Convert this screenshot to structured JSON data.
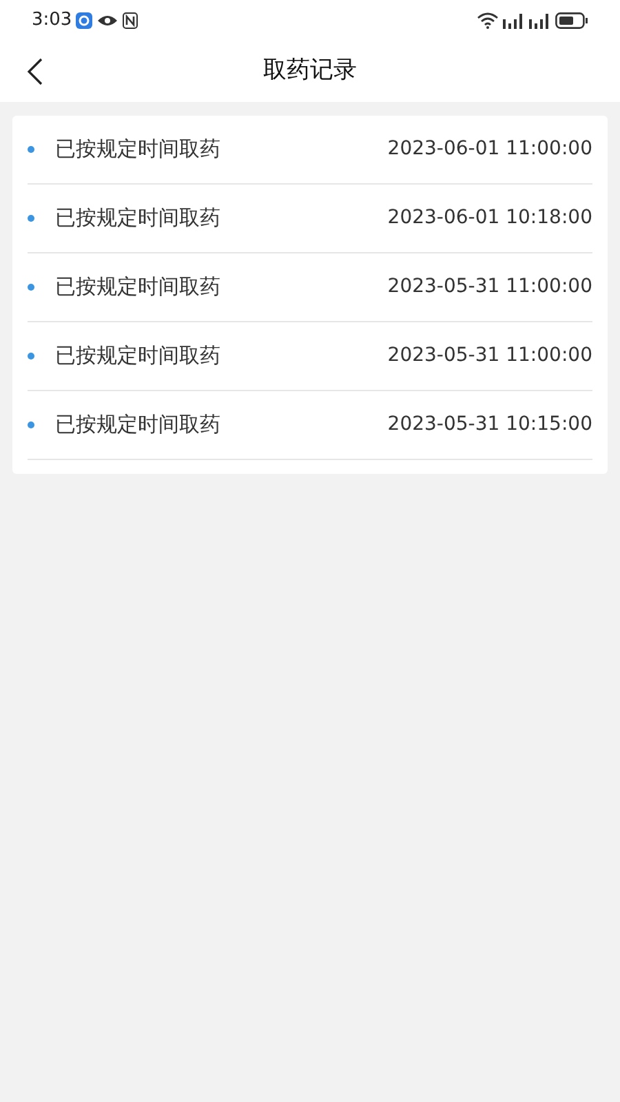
{
  "status_bar": {
    "time": "3:03"
  },
  "header": {
    "title": "取药记录"
  },
  "records": [
    {
      "label": "已按规定时间取药",
      "time": "2023-06-01 11:00:00",
      "color": "#3b95e0"
    },
    {
      "label": "已按规定时间取药",
      "time": "2023-06-01 10:18:00",
      "color": "#3b95e0"
    },
    {
      "label": "已按规定时间取药",
      "time": "2023-05-31 11:00:00",
      "color": "#3b95e0"
    },
    {
      "label": "已按规定时间取药",
      "time": "2023-05-31 11:00:00",
      "color": "#3b95e0"
    },
    {
      "label": "已按规定时间取药",
      "time": "2023-05-31 10:15:00",
      "color": "#3b95e0"
    }
  ]
}
